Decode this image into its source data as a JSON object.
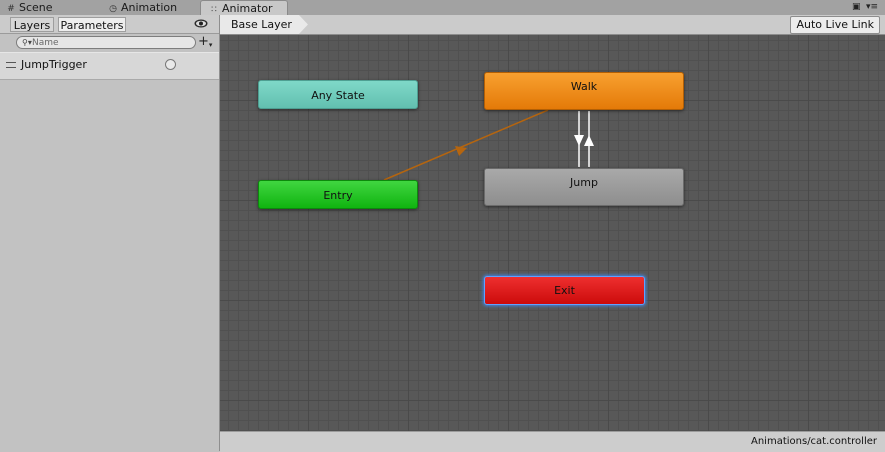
{
  "window_tabs": [
    {
      "label": "Scene",
      "icon": "grid-icon"
    },
    {
      "label": "Animation",
      "icon": "clock-icon"
    },
    {
      "label": "Animator",
      "icon": "animator-nodes-icon",
      "active": true
    }
  ],
  "left_panel": {
    "tabs": [
      {
        "label": "Layers",
        "active": false
      },
      {
        "label": "Parameters",
        "active": true
      }
    ],
    "search": {
      "placeholder": "Name",
      "value": ""
    },
    "parameters": [
      {
        "name": "JumpTrigger",
        "type": "trigger",
        "value": false
      }
    ]
  },
  "graph": {
    "breadcrumb": "Base Layer",
    "live_link_label": "Auto Live Link",
    "states": {
      "any_state": {
        "label": "Any State",
        "color": "#6fcdbd"
      },
      "entry": {
        "label": "Entry",
        "color": "#22c522"
      },
      "walk": {
        "label": "Walk",
        "color": "#f08b1a",
        "default": true
      },
      "jump": {
        "label": "Jump",
        "color": "#9b9b9b"
      },
      "exit": {
        "label": "Exit",
        "color": "#dc1d1d",
        "selected": true
      }
    },
    "transitions": [
      {
        "from": "Entry",
        "to": "Walk",
        "color": "#b5650f"
      },
      {
        "from": "Walk",
        "to": "Jump",
        "color": "#ffffff"
      },
      {
        "from": "Jump",
        "to": "Walk",
        "color": "#ffffff"
      }
    ]
  },
  "status": {
    "controller_path": "Animations/cat.controller"
  }
}
